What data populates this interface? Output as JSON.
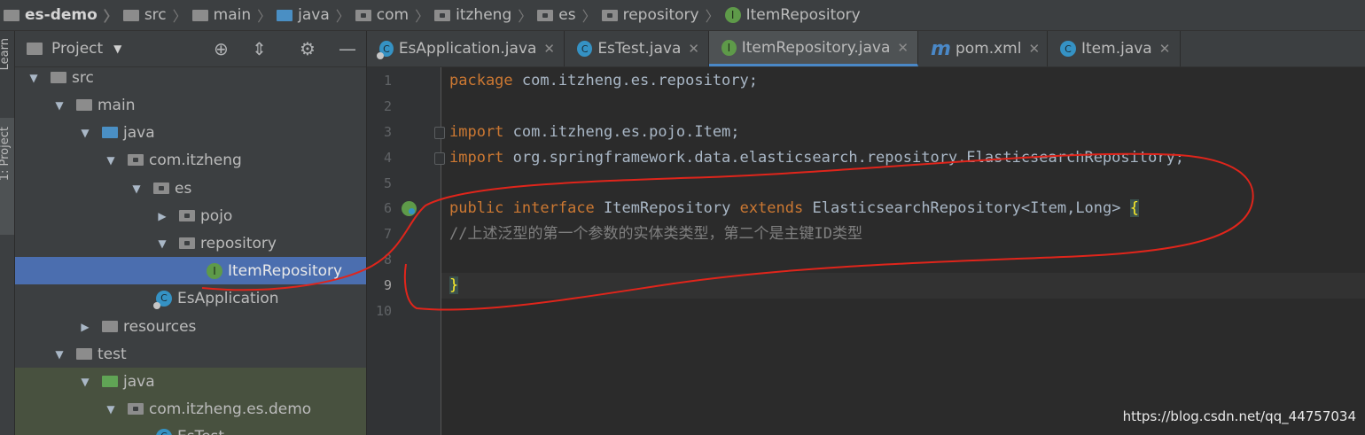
{
  "breadcrumb": [
    "es-demo",
    "src",
    "main",
    "java",
    "com",
    "itzheng",
    "es",
    "repository",
    "ItemRepository"
  ],
  "left_strip": {
    "learn_label": "Learn",
    "project_label": "1: Project"
  },
  "project_panel": {
    "title": "Project",
    "tree": [
      {
        "label": "src",
        "arrow": "▼"
      },
      {
        "label": "main",
        "arrow": "▼"
      },
      {
        "label": "java",
        "arrow": "▼"
      },
      {
        "label": "com.itzheng",
        "arrow": "▼"
      },
      {
        "label": "es",
        "arrow": "▼"
      },
      {
        "label": "pojo",
        "arrow": "▶"
      },
      {
        "label": "repository",
        "arrow": "▼"
      },
      {
        "label": "ItemRepository",
        "arrow": ""
      },
      {
        "label": "EsApplication",
        "arrow": ""
      },
      {
        "label": "resources",
        "arrow": "▶"
      },
      {
        "label": "test",
        "arrow": "▼"
      },
      {
        "label": "java",
        "arrow": "▼"
      },
      {
        "label": "com.itzheng.es.demo",
        "arrow": "▼"
      },
      {
        "label": "EsTest",
        "arrow": ""
      }
    ]
  },
  "tabs": [
    {
      "label": "EsApplication.java",
      "icon": "spring-class-icon"
    },
    {
      "label": "EsTest.java",
      "icon": "class-icon"
    },
    {
      "label": "ItemRepository.java",
      "icon": "interface-icon",
      "active": true
    },
    {
      "label": "pom.xml",
      "icon": "maven-icon"
    },
    {
      "label": "Item.java",
      "icon": "class-icon"
    }
  ],
  "editor": {
    "line_numbers": [
      "1",
      "2",
      "3",
      "4",
      "5",
      "6",
      "7",
      "8",
      "9",
      "10"
    ],
    "lines": {
      "l1_kw": "package",
      "l1_rest": " com.itzheng.es.repository;",
      "l3_kw": "import",
      "l3_rest": " com.itzheng.es.pojo.Item;",
      "l4_kw": "import",
      "l4_rest": " org.springframework.data.elasticsearch.repository.ElasticsearchRepository;",
      "l6_kw1": "public",
      "l6_kw2": "interface",
      "l6_name": "ItemRepository",
      "l6_kw3": "extends",
      "l6_type": "ElasticsearchRepository",
      "l6_generic": "<Item,Long>",
      "l6_brace": "{",
      "l7_comment": "//上述泛型的第一个参数的实体类类型，第二个是主键ID类型",
      "l9_brace": "}"
    }
  },
  "watermark": "https://blog.csdn.net/qq_44757034",
  "colors": {
    "keyword": "#cc7832",
    "comment": "#808080",
    "annotation": "#e0251b",
    "selection": "#4b6eaf"
  }
}
